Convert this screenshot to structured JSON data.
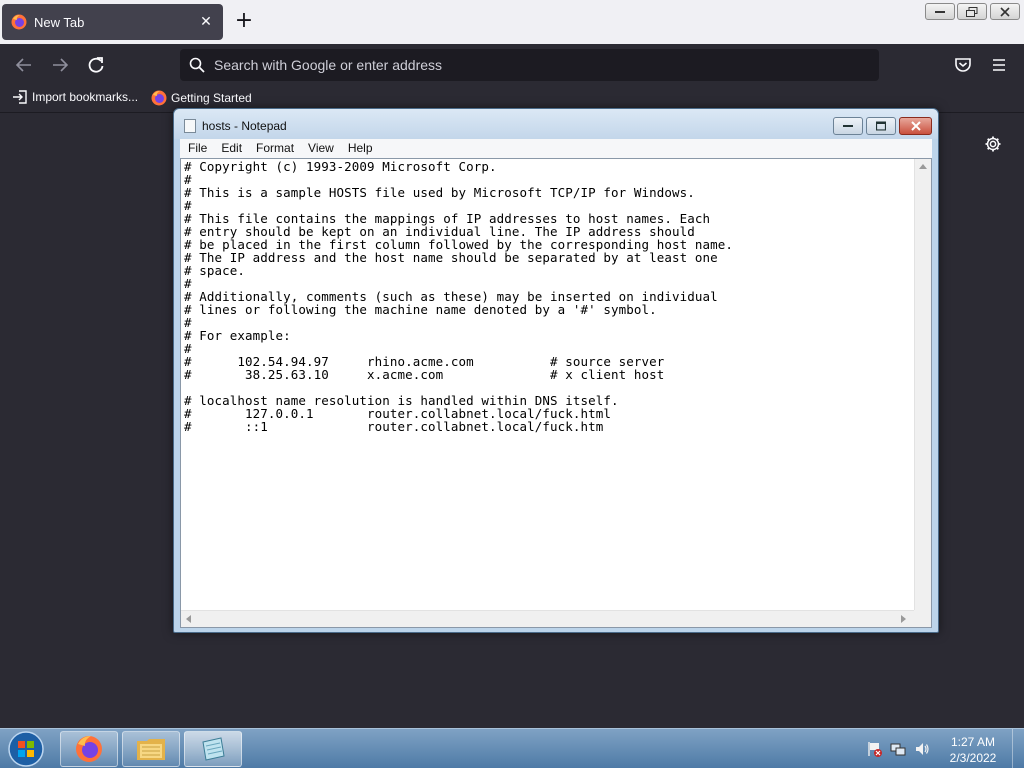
{
  "browser": {
    "tab": {
      "title": "New Tab"
    },
    "urlbar": {
      "placeholder": "Search with Google or enter address"
    },
    "bookmarks": [
      {
        "label": "Import bookmarks..."
      },
      {
        "label": "Getting Started"
      }
    ]
  },
  "notepad": {
    "title": "hosts - Notepad",
    "menu": [
      "File",
      "Edit",
      "Format",
      "View",
      "Help"
    ],
    "content": "# Copyright (c) 1993-2009 Microsoft Corp.\n#\n# This is a sample HOSTS file used by Microsoft TCP/IP for Windows.\n#\n# This file contains the mappings of IP addresses to host names. Each\n# entry should be kept on an individual line. The IP address should\n# be placed in the first column followed by the corresponding host name.\n# The IP address and the host name should be separated by at least one\n# space.\n#\n# Additionally, comments (such as these) may be inserted on individual\n# lines or following the machine name denoted by a '#' symbol.\n#\n# For example:\n#\n#      102.54.94.97     rhino.acme.com          # source server\n#       38.25.63.10     x.acme.com              # x client host\n\n# localhost name resolution is handled within DNS itself.\n#\t127.0.0.1       router.collabnet.local/fuck.html\n#\t::1             router.collabnet.local/fuck.htm"
  },
  "taskbar": {
    "time": "1:27 AM",
    "date": "2/3/2022"
  },
  "colors": {
    "firefox_toolbar": "#2b2a33",
    "firefox_tabstrip": "#f0f0f4",
    "urlbar_bg": "#1c1b22",
    "notepad_frame": "#bcd4ea",
    "taskbar": "#4e7aa6"
  }
}
